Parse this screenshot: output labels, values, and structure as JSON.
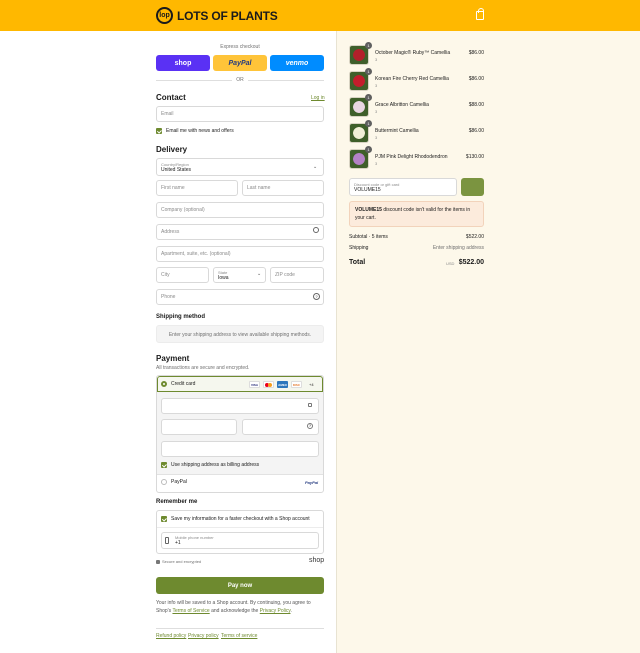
{
  "brand": {
    "name": "LOTS OF PLANTS",
    "mark": "lop"
  },
  "express": {
    "title": "Express checkout",
    "shop_label": "shop",
    "paypal_label": "PayPal",
    "venmo_label": "venmo",
    "or_label": "OR"
  },
  "contact": {
    "title": "Contact",
    "login_label": "Log in",
    "email_placeholder": "Email",
    "news_label": "Email me with news and offers"
  },
  "delivery": {
    "title": "Delivery",
    "country_label": "Country/Region",
    "country_value": "United States",
    "first_name": "First name",
    "last_name": "Last name",
    "company": "Company (optional)",
    "address": "Address",
    "apartment": "Apartment, suite, etc. (optional)",
    "city": "City",
    "state_label": "State",
    "state_value": "Iowa",
    "zip": "ZIP code",
    "phone": "Phone"
  },
  "shipping": {
    "title": "Shipping method",
    "message": "Enter your shipping address to view available shipping methods."
  },
  "payment": {
    "title": "Payment",
    "subtitle": "All transactions are secure and encrypted.",
    "credit_card_label": "Credit card",
    "card_icons": {
      "visa": "VISA",
      "amex": "AMEX",
      "discover": "DISC",
      "more": "+4"
    },
    "billing_label": "Use shipping address as billing address",
    "paypal_label": "PayPal",
    "paypal_logo": "PayPal"
  },
  "remember": {
    "title": "Remember me",
    "save_label": "Save my information for a faster checkout with a Shop account",
    "mobile_label": "Mobile phone number",
    "mobile_value": "+1",
    "secure_label": "Secure and encrypted",
    "shop_logo": "shop"
  },
  "paynow_label": "Pay now",
  "legal": {
    "text": "Your info will be saved to a Shop account. By continuing, you agree to Shop's",
    "terms": "Terms of Service",
    "and_text": "and acknowledge the",
    "privacy": "Privacy Policy",
    "end": "."
  },
  "footer": {
    "refund": "Refund policy",
    "privacy": "Privacy policy",
    "terms": "Terms of service"
  },
  "items": [
    {
      "name": "October Magic® Ruby™ Camellia",
      "qty": "1",
      "sub": "3",
      "price": "$86.00",
      "color": "#b3202a"
    },
    {
      "name": "Korean Fire Cherry Red Camellia",
      "qty": "1",
      "sub": "3",
      "price": "$86.00",
      "color": "#c31d2c"
    },
    {
      "name": "Grace Albritton Camellia",
      "qty": "1",
      "sub": "3",
      "price": "$88.00",
      "color": "#e9d6e2"
    },
    {
      "name": "Buttermint Camellia",
      "qty": "1",
      "sub": "3",
      "price": "$86.00",
      "color": "#f1efd7"
    },
    {
      "name": "PJM Pink Delight Rhododendron",
      "qty": "1",
      "sub": "3",
      "price": "$130.00",
      "color": "#b482c6"
    }
  ],
  "discount": {
    "label": "Discount code or gift card",
    "value": "VOLUME15",
    "error_code": "VOLUME15",
    "error_text": "discount code isn't valid for the items in your cart."
  },
  "totals": {
    "subtotal_label": "Subtotal · 5 items",
    "subtotal_value": "$522.00",
    "shipping_label": "Shipping",
    "shipping_value": "Enter shipping address",
    "total_label": "Total",
    "currency": "USD",
    "total_value": "$522.00"
  },
  "colors": {
    "accent": "#6e8a2f",
    "header": "#ffb800",
    "summary_bg": "#fdf8ea"
  }
}
